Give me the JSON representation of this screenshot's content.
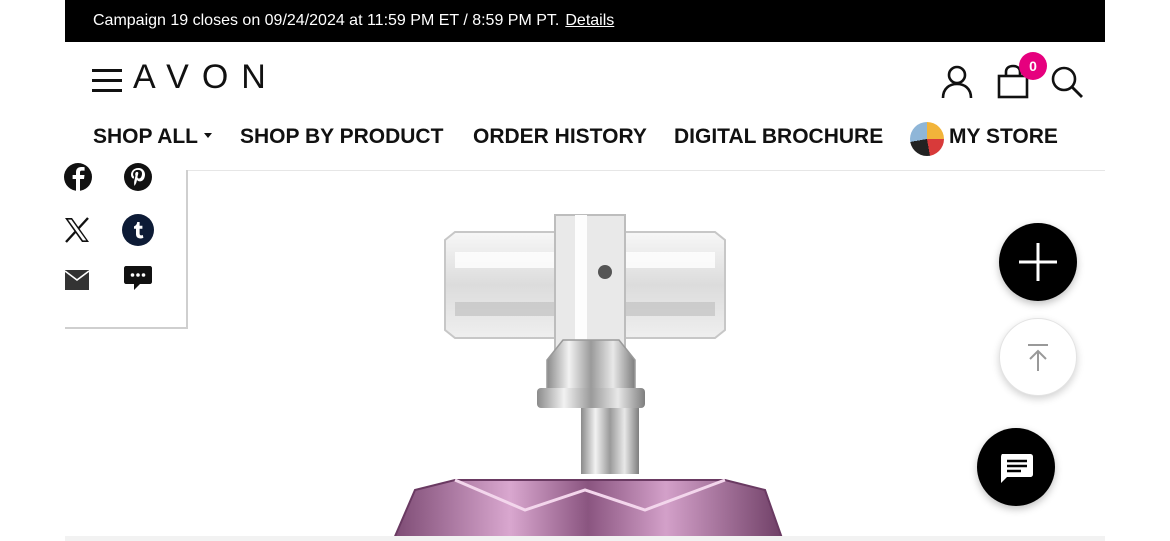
{
  "promo_bar": {
    "message": "Campaign 19 closes on 09/24/2024 at 11:59 PM ET / 8:59 PM PT.",
    "link_label": "Details"
  },
  "header": {
    "logo_text": "AVON",
    "cart_count": "0",
    "badge_color": "#e6007e",
    "icons": [
      "menu-icon",
      "account-icon",
      "shopping-bag-icon",
      "search-icon"
    ]
  },
  "nav": {
    "items": [
      {
        "label": "SHOP ALL",
        "has_dropdown": true
      },
      {
        "label": "SHOP BY PRODUCT"
      },
      {
        "label": "ORDER HISTORY"
      },
      {
        "label": "DIGITAL BROCHURE"
      },
      {
        "label": "MY STORE"
      }
    ]
  },
  "share": {
    "icons": [
      "facebook-icon",
      "pinterest-icon",
      "x-icon",
      "tumblr-icon",
      "email-icon",
      "sms-icon"
    ]
  },
  "floating_buttons": {
    "icons": [
      "plus-icon",
      "arrow-up-icon",
      "chat-icon"
    ]
  }
}
